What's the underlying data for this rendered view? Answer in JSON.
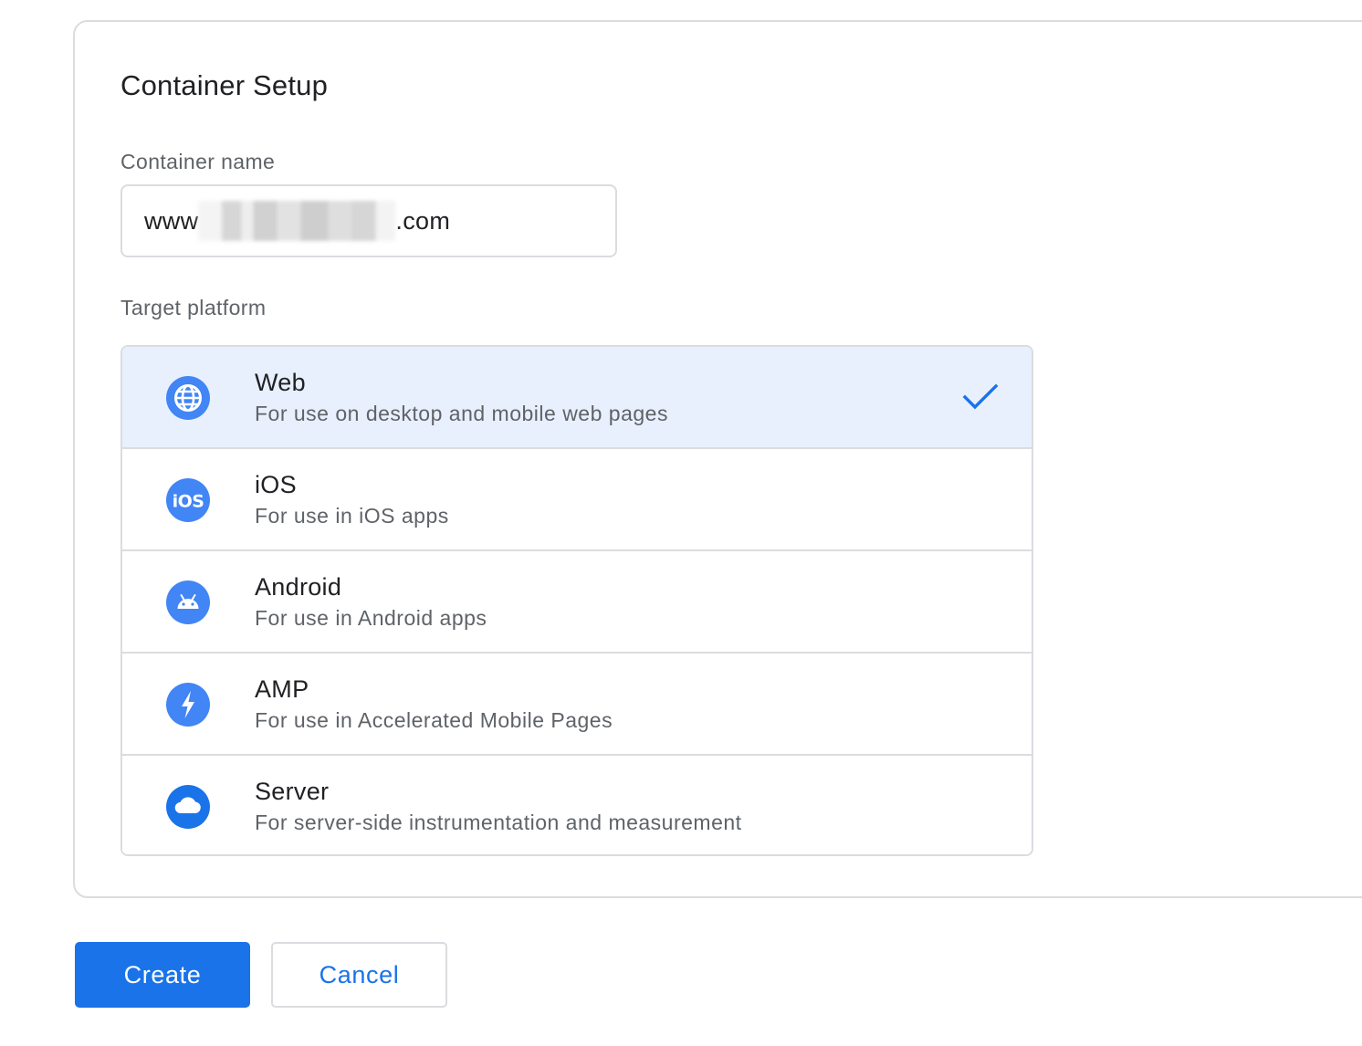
{
  "dialog": {
    "title": "Container Setup",
    "container_name_label": "Container name",
    "container_name_prefix": "www",
    "container_name_suffix": ".com",
    "target_platform_label": "Target platform"
  },
  "platforms": [
    {
      "name": "Web",
      "description": "For use on desktop and mobile web pages",
      "icon": "globe-icon",
      "selected": true
    },
    {
      "name": "iOS",
      "description": "For use in iOS apps",
      "icon": "ios-icon",
      "selected": false
    },
    {
      "name": "Android",
      "description": "For use in Android apps",
      "icon": "android-icon",
      "selected": false
    },
    {
      "name": "AMP",
      "description": "For use in Accelerated Mobile Pages",
      "icon": "lightning-icon",
      "selected": false
    },
    {
      "name": "Server",
      "description": "For server-side instrumentation and measurement",
      "icon": "cloud-icon",
      "selected": false
    }
  ],
  "actions": {
    "create_label": "Create",
    "cancel_label": "Cancel"
  },
  "colors": {
    "accent": "#1a73e8",
    "icon_blue": "#4285f4",
    "selected_bg": "#e8f0fe",
    "border": "#dadce0"
  }
}
